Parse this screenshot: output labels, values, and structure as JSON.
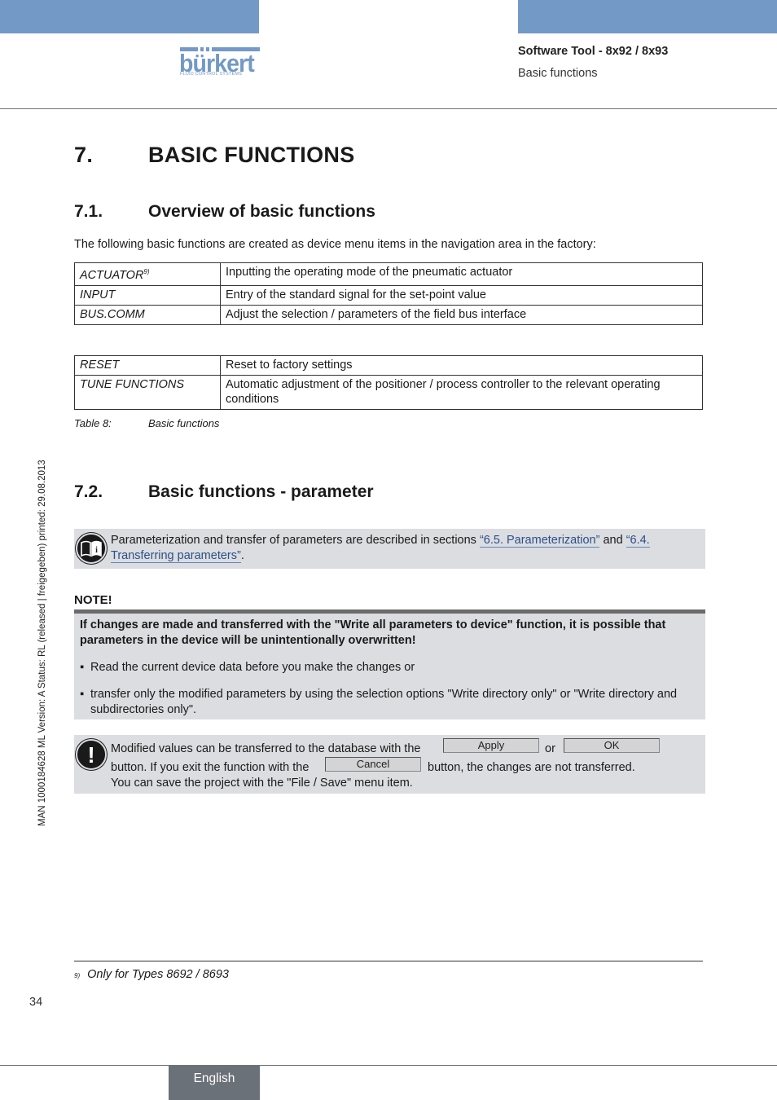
{
  "header": {
    "logo_text": "bürkert",
    "logo_subtitle": "FLUID CONTROL SYSTEMS",
    "title": "Software Tool - 8x92 / 8x93",
    "subtitle": "Basic functions",
    "brand_color": "#7399c6"
  },
  "side_label": "MAN  1000184628  ML  Version: A  Status: RL (released | freigegeben)  printed: 29.08.2013",
  "chapter": {
    "number": "7.",
    "title": "BASIC FUNCTIONS"
  },
  "section1": {
    "number": "7.1.",
    "title": "Overview of basic functions",
    "intro": "The following basic functions are created as device menu items in the navigation area in the factory:",
    "table1": [
      {
        "key": "ACTUATOR",
        "sup": "9)",
        "value": "Inputting the operating mode of the pneumatic actuator"
      },
      {
        "key": "INPUT",
        "sup": "",
        "value": "Entry of the standard signal for the set-point value"
      },
      {
        "key": "BUS.COMM",
        "sup": "",
        "value": "Adjust the selection / parameters of the field bus interface"
      }
    ],
    "table2": [
      {
        "key": "RESET",
        "value": "Reset to factory settings"
      },
      {
        "key": "TUNE FUNCTIONS",
        "value": "Automatic adjustment of the positioner / process controller to the relevant operating conditions"
      }
    ],
    "caption_label": "Table 8:",
    "caption_text": "Basic functions"
  },
  "section2": {
    "number": "7.2.",
    "title": "Basic functions - parameter",
    "info": {
      "text_before": "Parameterization and transfer of parameters are described in sections ",
      "link1": "“6.5. Parameterization”",
      "text_mid": " and ",
      "link2": "“6.4. Transferring parameters”",
      "text_after": "."
    },
    "note": {
      "label": "NOTE!",
      "heading": "If changes are made and transferred with the \"Write all parameters to device\" function, it is possible that parameters in the device will be unintentionally overwritten!",
      "bullets": [
        "Read the current device data before you make the changes or",
        "transfer only the modified parameters by using the selection options \"Write directory only\" or \"Write directory and subdirectories only\"."
      ]
    },
    "warning": {
      "line1_before": "Modified values can be transferred to the database with the",
      "or": "or",
      "line2_before": "button. If you exit the function with the",
      "line2_after": "button, the changes are not transferred.",
      "line3": "You can save the project with the \"File / Save\" menu item.",
      "apply_label": "Apply",
      "ok_label": "OK",
      "cancel_label": "Cancel"
    }
  },
  "footnote": {
    "mark": "9)",
    "text": "Only for Types 8692 / 8693"
  },
  "page_number": "34",
  "language_tab": "English"
}
